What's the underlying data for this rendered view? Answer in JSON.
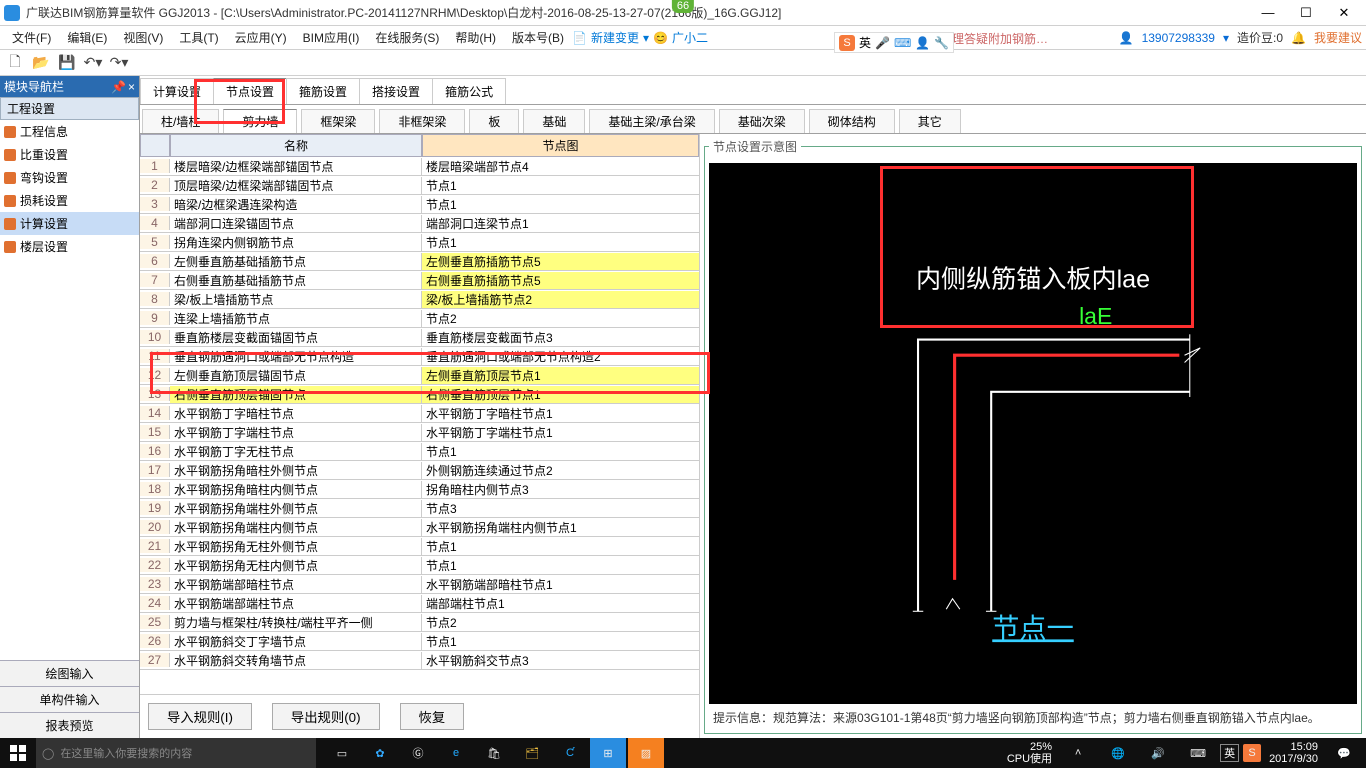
{
  "title": "广联达BIM钢筋算量软件 GGJ2013 - [C:\\Users\\Administrator.PC-20141127NRHM\\Desktop\\白龙村-2016-08-25-13-27-07(2166版)_16G.GGJ12]",
  "badge": "66",
  "menus": [
    "文件(F)",
    "编辑(E)",
    "视图(V)",
    "工具(T)",
    "云应用(Y)",
    "BIM应用(I)",
    "在线服务(S)",
    "帮助(H)",
    "版本号(B)"
  ],
  "menu_extra": {
    "new_change": "新建变更",
    "user": "广小二"
  },
  "right_bar": {
    "account": "13907298339",
    "friend": "造价豆:0",
    "feedback": "我要建议"
  },
  "popup": "如何处理答疑附加钢筋…",
  "nav": {
    "title": "模块导航栏",
    "group": "工程设置",
    "items": [
      "工程信息",
      "比重设置",
      "弯钩设置",
      "损耗设置",
      "计算设置",
      "楼层设置"
    ],
    "selected": 4,
    "bottom": [
      "绘图输入",
      "单构件输入",
      "报表预览"
    ]
  },
  "tabs1": [
    "计算设置",
    "节点设置",
    "箍筋设置",
    "搭接设置",
    "箍筋公式"
  ],
  "tabs1_active": 1,
  "tabs2": [
    "柱/墙柱",
    "剪力墙",
    "框架梁",
    "非框架梁",
    "板",
    "基础",
    "基础主梁/承台梁",
    "基础次梁",
    "砌体结构",
    "其它"
  ],
  "tabs2_active": 1,
  "table_headers": {
    "idx": "",
    "name": "名称",
    "graph": "节点图"
  },
  "rows": [
    {
      "i": 1,
      "a": "楼层暗梁/边框梁端部锚固节点",
      "b": "楼层暗梁端部节点4"
    },
    {
      "i": 2,
      "a": "顶层暗梁/边框梁端部锚固节点",
      "b": "节点1"
    },
    {
      "i": 3,
      "a": "暗梁/边框梁遇连梁构造",
      "b": "节点1"
    },
    {
      "i": 4,
      "a": "端部洞口连梁锚固节点",
      "b": "端部洞口连梁节点1"
    },
    {
      "i": 5,
      "a": "拐角连梁内侧钢筋节点",
      "b": "节点1"
    },
    {
      "i": 6,
      "a": "左侧垂直筋基础插筋节点",
      "b": "左侧垂直筋插筋节点5",
      "hl": true
    },
    {
      "i": 7,
      "a": "右侧垂直筋基础插筋节点",
      "b": "右侧垂直筋插筋节点5",
      "hl": true
    },
    {
      "i": 8,
      "a": "梁/板上墙插筋节点",
      "b": "梁/板上墙插筋节点2",
      "hl": true
    },
    {
      "i": 9,
      "a": "连梁上墙插筋节点",
      "b": "节点2"
    },
    {
      "i": 10,
      "a": "垂直筋楼层变截面锚固节点",
      "b": "垂直筋楼层变截面节点3"
    },
    {
      "i": 11,
      "a": "垂直钢筋遇洞口或端部无节点构造",
      "b": "垂直筋遇洞口或端部无节点构造2"
    },
    {
      "i": 12,
      "a": "左侧垂直筋顶层锚固节点",
      "b": "左侧垂直筋顶层节点1",
      "hl": true
    },
    {
      "i": 13,
      "a": "右侧垂直筋顶层锚固节点",
      "b": "右侧垂直筋顶层节点1",
      "hl": true,
      "sel": true
    },
    {
      "i": 14,
      "a": "水平钢筋丁字暗柱节点",
      "b": "水平钢筋丁字暗柱节点1"
    },
    {
      "i": 15,
      "a": "水平钢筋丁字端柱节点",
      "b": "水平钢筋丁字端柱节点1"
    },
    {
      "i": 16,
      "a": "水平钢筋丁字无柱节点",
      "b": "节点1"
    },
    {
      "i": 17,
      "a": "水平钢筋拐角暗柱外侧节点",
      "b": "外侧钢筋连续通过节点2"
    },
    {
      "i": 18,
      "a": "水平钢筋拐角暗柱内侧节点",
      "b": "拐角暗柱内侧节点3"
    },
    {
      "i": 19,
      "a": "水平钢筋拐角端柱外侧节点",
      "b": "节点3"
    },
    {
      "i": 20,
      "a": "水平钢筋拐角端柱内侧节点",
      "b": "水平钢筋拐角端柱内侧节点1"
    },
    {
      "i": 21,
      "a": "水平钢筋拐角无柱外侧节点",
      "b": "节点1"
    },
    {
      "i": 22,
      "a": "水平钢筋拐角无柱内侧节点",
      "b": "节点1"
    },
    {
      "i": 23,
      "a": "水平钢筋端部暗柱节点",
      "b": "水平钢筋端部暗柱节点1"
    },
    {
      "i": 24,
      "a": "水平钢筋端部端柱节点",
      "b": "端部端柱节点1"
    },
    {
      "i": 25,
      "a": "剪力墙与框架柱/转换柱/端柱平齐一侧",
      "b": "节点2"
    },
    {
      "i": 26,
      "a": "水平钢筋斜交丁字墙节点",
      "b": "节点1"
    },
    {
      "i": 27,
      "a": "水平钢筋斜交转角墙节点",
      "b": "水平钢筋斜交节点3"
    }
  ],
  "preview": {
    "legend": "节点设置示意图",
    "label1": "内侧纵筋锚入板内lae",
    "label2": "laE",
    "label3": "节点一",
    "hint_prefix": "提示信息：",
    "hint": "规范算法：来源03G101-1第48页“剪力墙竖向钢筋顶部构造”节点；剪力墙右侧垂直钢筋锚入节点内lae。"
  },
  "buttons": {
    "import": "导入规则(I)",
    "export": "导出规则(0)",
    "restore": "恢复"
  },
  "taskbar": {
    "search": "在这里输入你要搜索的内容",
    "cpu_pct": "25%",
    "cpu_lbl": "CPU使用",
    "time": "15:09",
    "date": "2017/9/30"
  },
  "sogou": "英"
}
